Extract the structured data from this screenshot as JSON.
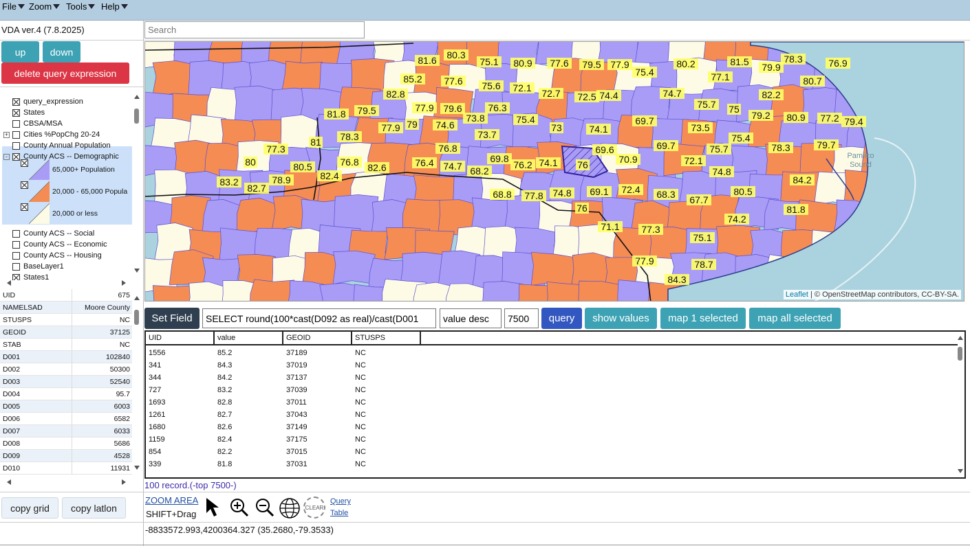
{
  "menus": [
    "File",
    "Zoom",
    "Tools",
    "Help"
  ],
  "version": "VDA ver.4 (7.8.2025)",
  "search": {
    "placeholder": "Search"
  },
  "buttons": {
    "up": "up",
    "down": "down",
    "delete_query": "delete query expression",
    "copy_grid": "copy grid",
    "copy_latlon": "copy latlon"
  },
  "layers": [
    {
      "label": "query_expression",
      "checked": true,
      "expander": ""
    },
    {
      "label": "States",
      "checked": true,
      "expander": ""
    },
    {
      "label": "CBSA/MSA",
      "checked": false,
      "expander": ""
    },
    {
      "label": "Cities %PopChg 20-24",
      "checked": false,
      "expander": "+"
    },
    {
      "label": "County Annual Population",
      "checked": false,
      "expander": ""
    },
    {
      "label": "County ACS -- Demographic",
      "checked": true,
      "expander": "-"
    },
    {
      "label": "County ACS -- Social",
      "checked": false,
      "expander": ""
    },
    {
      "label": "County ACS -- Economic",
      "checked": false,
      "expander": ""
    },
    {
      "label": "County ACS -- Housing",
      "checked": false,
      "expander": ""
    },
    {
      "label": "BaseLayer1",
      "checked": false,
      "expander": ""
    },
    {
      "label": "States1",
      "checked": true,
      "expander": ""
    }
  ],
  "legend": [
    {
      "label": "65,000+ Population",
      "color": "#a99cf6"
    },
    {
      "label": "20,000 - 65,000 Popula",
      "color": "#f48c54"
    },
    {
      "label": "20,000 or less",
      "color": "#fdfbe6"
    }
  ],
  "properties": [
    {
      "key": "UID",
      "value": "675"
    },
    {
      "key": "NAMELSAD",
      "value": "Moore County"
    },
    {
      "key": "STUSPS",
      "value": "NC"
    },
    {
      "key": "GEOID",
      "value": "37125"
    },
    {
      "key": "STAB",
      "value": "NC"
    },
    {
      "key": "D001",
      "value": "102840"
    },
    {
      "key": "D002",
      "value": "50300"
    },
    {
      "key": "D003",
      "value": "52540"
    },
    {
      "key": "D004",
      "value": "95.7"
    },
    {
      "key": "D005",
      "value": "6003"
    },
    {
      "key": "D006",
      "value": "6582"
    },
    {
      "key": "D007",
      "value": "6033"
    },
    {
      "key": "D008",
      "value": "5686"
    },
    {
      "key": "D009",
      "value": "4528"
    },
    {
      "key": "D010",
      "value": "11931"
    }
  ],
  "map": {
    "attribution_link": "Leaflet",
    "attribution_text": " | © OpenStreetMap contributors, CC-BY-SA.",
    "sound_label": "Pamlico Sound",
    "colors": {
      "high": "#a99cf6",
      "mid": "#f48c54",
      "low": "#fdfbe6",
      "water": "#aad3df",
      "label_bg": "#ffff66"
    },
    "labels": [
      "81.6",
      "80.3",
      "75.1",
      "80.9",
      "77.6",
      "79.5",
      "77.9",
      "75.4",
      "80.2",
      "81.5",
      "79.9",
      "78.3",
      "76.9",
      "85.2",
      "77.6",
      "75.6",
      "72.1",
      "77.1",
      "80.7",
      "82.8",
      "77.9",
      "79.6",
      "76.3",
      "72.7",
      "72.5",
      "74.4",
      "74.7",
      "75.7",
      "75",
      "82.2",
      "81.8",
      "79.5",
      "73.8",
      "75.4",
      "69.7",
      "79.2",
      "80.9",
      "77.2",
      "79.4",
      "77.9",
      "79",
      "74.6",
      "73.7",
      "73",
      "74.1",
      "73.5",
      "75.4",
      "78.3",
      "81",
      "76.8",
      "69.7",
      "75.7",
      "79.7",
      "77.3",
      "76.8",
      "82.6",
      "76.4",
      "74.7",
      "69.8",
      "76.2",
      "74.1",
      "76",
      "69.6",
      "70.9",
      "72.1",
      "78.3",
      "80",
      "80.5",
      "68.2",
      "74.8",
      "84.2",
      "83.2",
      "78.9",
      "82.4",
      "82.7",
      "68.8",
      "77.8",
      "74.8",
      "69.1",
      "72.4",
      "68.3",
      "67.7",
      "80.5",
      "76",
      "71.1",
      "81.8",
      "74.2",
      "77.3",
      "75.1",
      "77.9",
      "78.7",
      "84.3"
    ]
  },
  "query": {
    "set_field": "Set Field",
    "sql": "SELECT round(100*cast(D092 as real)/cast(D001",
    "order": "value desc",
    "limit": "7500",
    "query_btn": "query",
    "show_values": "show values",
    "map1": "map 1 selected",
    "mapall": "map all selected"
  },
  "grid": {
    "columns": [
      "UID",
      "value",
      "GEOID",
      "STUSPS"
    ],
    "rows": [
      [
        "1556",
        "85.2",
        "37189",
        "NC"
      ],
      [
        "341",
        "84.3",
        "37019",
        "NC"
      ],
      [
        "344",
        "84.2",
        "37137",
        "NC"
      ],
      [
        "727",
        "83.2",
        "37039",
        "NC"
      ],
      [
        "1693",
        "82.8",
        "37011",
        "NC"
      ],
      [
        "1261",
        "82.7",
        "37043",
        "NC"
      ],
      [
        "1680",
        "82.6",
        "37149",
        "NC"
      ],
      [
        "1159",
        "82.4",
        "37175",
        "NC"
      ],
      [
        "854",
        "82.2",
        "37015",
        "NC"
      ],
      [
        "339",
        "81.8",
        "37031",
        "NC"
      ]
    ]
  },
  "record_count": "100 record.(-top 7500-)",
  "tools": {
    "zoom_area": "ZOOM AREA",
    "shift_drag": "SHIFT+Drag",
    "clear": "CLEAR",
    "query": "Query",
    "table": "Table"
  },
  "coords": "-8833572.993,4200364.327 (35.2680,-79.3533)"
}
